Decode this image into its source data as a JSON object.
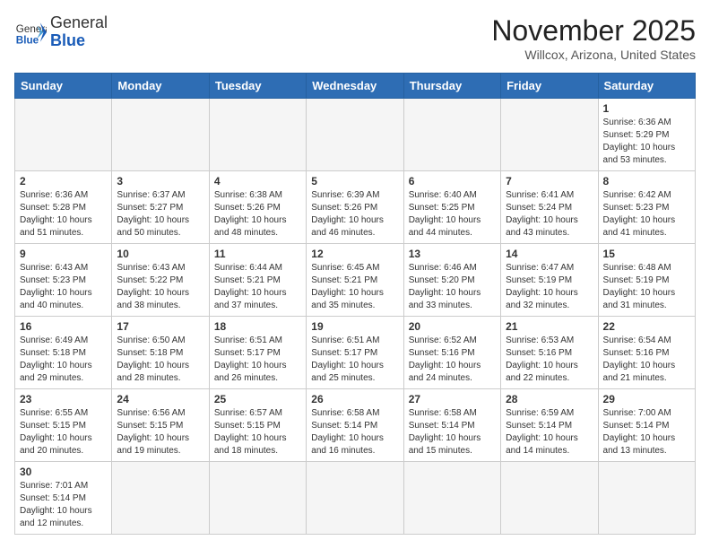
{
  "header": {
    "logo": {
      "general": "General",
      "blue": "Blue"
    },
    "title": "November 2025",
    "subtitle": "Willcox, Arizona, United States"
  },
  "weekdays": [
    "Sunday",
    "Monday",
    "Tuesday",
    "Wednesday",
    "Thursday",
    "Friday",
    "Saturday"
  ],
  "weeks": [
    [
      {
        "day": "",
        "empty": true
      },
      {
        "day": "",
        "empty": true
      },
      {
        "day": "",
        "empty": true
      },
      {
        "day": "",
        "empty": true
      },
      {
        "day": "",
        "empty": true
      },
      {
        "day": "",
        "empty": true
      },
      {
        "day": "1",
        "sunrise": "6:36 AM",
        "sunset": "5:29 PM",
        "daylight": "10 hours and 53 minutes."
      }
    ],
    [
      {
        "day": "2",
        "sunrise": "6:36 AM",
        "sunset": "5:28 PM",
        "daylight": "10 hours and 51 minutes."
      },
      {
        "day": "3",
        "sunrise": "6:37 AM",
        "sunset": "5:27 PM",
        "daylight": "10 hours and 50 minutes."
      },
      {
        "day": "4",
        "sunrise": "6:38 AM",
        "sunset": "5:26 PM",
        "daylight": "10 hours and 48 minutes."
      },
      {
        "day": "5",
        "sunrise": "6:39 AM",
        "sunset": "5:26 PM",
        "daylight": "10 hours and 46 minutes."
      },
      {
        "day": "6",
        "sunrise": "6:40 AM",
        "sunset": "5:25 PM",
        "daylight": "10 hours and 44 minutes."
      },
      {
        "day": "7",
        "sunrise": "6:41 AM",
        "sunset": "5:24 PM",
        "daylight": "10 hours and 43 minutes."
      },
      {
        "day": "8",
        "sunrise": "6:42 AM",
        "sunset": "5:23 PM",
        "daylight": "10 hours and 41 minutes."
      }
    ],
    [
      {
        "day": "9",
        "sunrise": "6:43 AM",
        "sunset": "5:23 PM",
        "daylight": "10 hours and 40 minutes."
      },
      {
        "day": "10",
        "sunrise": "6:43 AM",
        "sunset": "5:22 PM",
        "daylight": "10 hours and 38 minutes."
      },
      {
        "day": "11",
        "sunrise": "6:44 AM",
        "sunset": "5:21 PM",
        "daylight": "10 hours and 37 minutes."
      },
      {
        "day": "12",
        "sunrise": "6:45 AM",
        "sunset": "5:21 PM",
        "daylight": "10 hours and 35 minutes."
      },
      {
        "day": "13",
        "sunrise": "6:46 AM",
        "sunset": "5:20 PM",
        "daylight": "10 hours and 33 minutes."
      },
      {
        "day": "14",
        "sunrise": "6:47 AM",
        "sunset": "5:19 PM",
        "daylight": "10 hours and 32 minutes."
      },
      {
        "day": "15",
        "sunrise": "6:48 AM",
        "sunset": "5:19 PM",
        "daylight": "10 hours and 31 minutes."
      }
    ],
    [
      {
        "day": "16",
        "sunrise": "6:49 AM",
        "sunset": "5:18 PM",
        "daylight": "10 hours and 29 minutes."
      },
      {
        "day": "17",
        "sunrise": "6:50 AM",
        "sunset": "5:18 PM",
        "daylight": "10 hours and 28 minutes."
      },
      {
        "day": "18",
        "sunrise": "6:51 AM",
        "sunset": "5:17 PM",
        "daylight": "10 hours and 26 minutes."
      },
      {
        "day": "19",
        "sunrise": "6:51 AM",
        "sunset": "5:17 PM",
        "daylight": "10 hours and 25 minutes."
      },
      {
        "day": "20",
        "sunrise": "6:52 AM",
        "sunset": "5:16 PM",
        "daylight": "10 hours and 24 minutes."
      },
      {
        "day": "21",
        "sunrise": "6:53 AM",
        "sunset": "5:16 PM",
        "daylight": "10 hours and 22 minutes."
      },
      {
        "day": "22",
        "sunrise": "6:54 AM",
        "sunset": "5:16 PM",
        "daylight": "10 hours and 21 minutes."
      }
    ],
    [
      {
        "day": "23",
        "sunrise": "6:55 AM",
        "sunset": "5:15 PM",
        "daylight": "10 hours and 20 minutes."
      },
      {
        "day": "24",
        "sunrise": "6:56 AM",
        "sunset": "5:15 PM",
        "daylight": "10 hours and 19 minutes."
      },
      {
        "day": "25",
        "sunrise": "6:57 AM",
        "sunset": "5:15 PM",
        "daylight": "10 hours and 18 minutes."
      },
      {
        "day": "26",
        "sunrise": "6:58 AM",
        "sunset": "5:14 PM",
        "daylight": "10 hours and 16 minutes."
      },
      {
        "day": "27",
        "sunrise": "6:58 AM",
        "sunset": "5:14 PM",
        "daylight": "10 hours and 15 minutes."
      },
      {
        "day": "28",
        "sunrise": "6:59 AM",
        "sunset": "5:14 PM",
        "daylight": "10 hours and 14 minutes."
      },
      {
        "day": "29",
        "sunrise": "7:00 AM",
        "sunset": "5:14 PM",
        "daylight": "10 hours and 13 minutes."
      }
    ],
    [
      {
        "day": "30",
        "sunrise": "7:01 AM",
        "sunset": "5:14 PM",
        "daylight": "10 hours and 12 minutes."
      },
      {
        "day": "",
        "empty": true
      },
      {
        "day": "",
        "empty": true
      },
      {
        "day": "",
        "empty": true
      },
      {
        "day": "",
        "empty": true
      },
      {
        "day": "",
        "empty": true
      },
      {
        "day": "",
        "empty": true
      }
    ]
  ],
  "labels": {
    "sunrise": "Sunrise:",
    "sunset": "Sunset:",
    "daylight": "Daylight:"
  }
}
